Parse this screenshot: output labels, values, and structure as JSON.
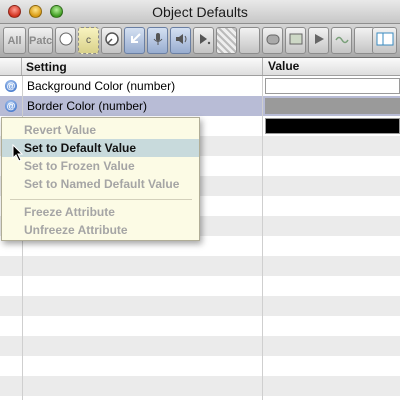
{
  "window": {
    "title": "Object Defaults"
  },
  "toolbar": {
    "buttons": [
      {
        "label": "All",
        "icon": "all-text"
      },
      {
        "label": "Patc",
        "icon": "patch-text"
      },
      {
        "label": "",
        "icon": "circle-icon"
      },
      {
        "label": "c",
        "icon": "comment-icon"
      },
      {
        "label": "",
        "icon": "dial-icon"
      },
      {
        "label": "",
        "icon": "arrow-icon"
      },
      {
        "label": "",
        "icon": "microphone-icon"
      },
      {
        "label": "",
        "icon": "speaker-icon"
      },
      {
        "label": "",
        "icon": "play-dot-icon"
      },
      {
        "label": "",
        "icon": "striped-icon"
      },
      {
        "label": "",
        "icon": "cylinder-icon"
      },
      {
        "label": "",
        "icon": "screen-icon"
      },
      {
        "label": "",
        "icon": "play-icon"
      },
      {
        "label": "",
        "icon": "wave-icon"
      },
      {
        "label": "",
        "icon": "grid-icon"
      }
    ]
  },
  "table": {
    "headers": {
      "setting": "Setting",
      "value": "Value"
    },
    "rows": [
      {
        "setting": "Background Color (number)",
        "value_color": "#ffffff"
      },
      {
        "setting": "Border Color (number)",
        "value_color": "#9a9a9a"
      },
      {
        "setting": "",
        "value_color": "#000000"
      }
    ],
    "badge_symbol": "@"
  },
  "context_menu": {
    "items": [
      {
        "label": "Revert Value",
        "enabled": false
      },
      {
        "label": "Set to Default Value",
        "enabled": true,
        "highlighted": true
      },
      {
        "label": "Set to Frozen Value",
        "enabled": false
      },
      {
        "label": "Set to Named Default Value",
        "enabled": false
      },
      {
        "label": "Freeze Attribute",
        "enabled": false
      },
      {
        "label": "Unfreeze Attribute",
        "enabled": false
      }
    ]
  }
}
